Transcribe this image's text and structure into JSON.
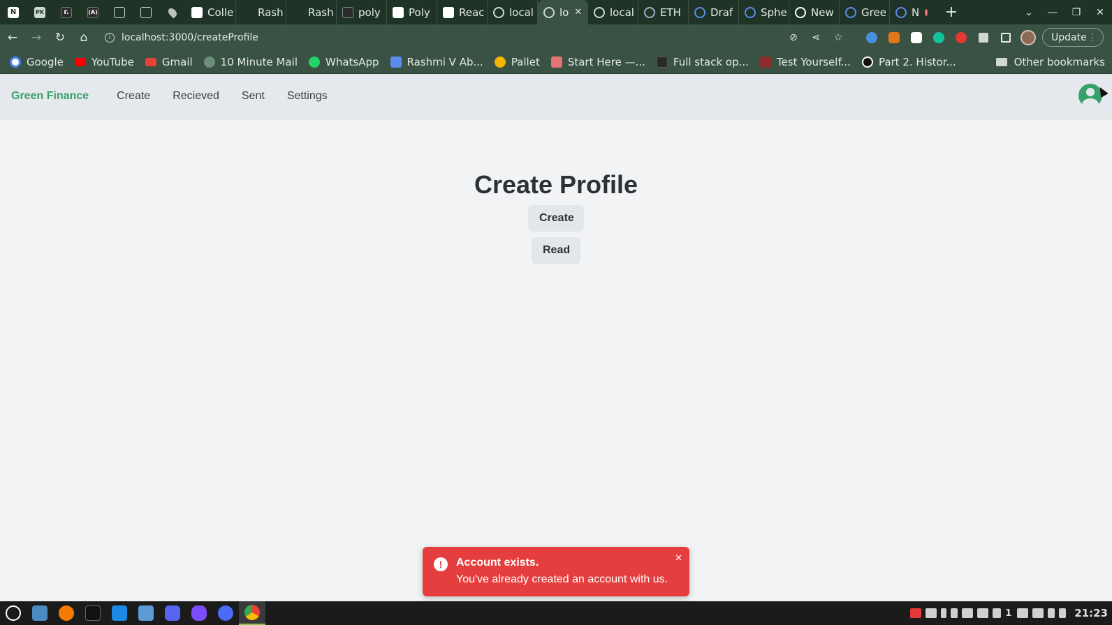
{
  "browser": {
    "pinned_tabs": [
      {
        "icon": "notion-icon",
        "glyph": "N"
      },
      {
        "icon": "pk-icon",
        "glyph": "PK"
      },
      {
        "icon": "r-icon",
        "glyph": "r."
      },
      {
        "icon": "a-icon",
        "glyph": "(A)"
      },
      {
        "icon": "blank-page-icon",
        "glyph": ""
      },
      {
        "icon": "doc-icon",
        "glyph": ""
      },
      {
        "icon": "drop-icon",
        "glyph": ""
      }
    ],
    "tabs": [
      {
        "label": "Colle",
        "active": false
      },
      {
        "label": "Rash",
        "active": false
      },
      {
        "label": "Rash",
        "active": false
      },
      {
        "label": "poly",
        "active": false
      },
      {
        "label": "Poly",
        "active": false
      },
      {
        "label": "Reac",
        "active": false
      },
      {
        "label": "local",
        "active": false
      },
      {
        "label": "lo",
        "active": true
      },
      {
        "label": "local",
        "active": false
      },
      {
        "label": "ETH",
        "active": false
      },
      {
        "label": "Draf",
        "active": false
      },
      {
        "label": "Sphe",
        "active": false
      },
      {
        "label": "New",
        "active": false
      },
      {
        "label": "Gree",
        "active": false
      },
      {
        "label": "N",
        "active": false
      }
    ],
    "address": {
      "url": "localhost:3000/createProfile"
    },
    "update_label": "Update",
    "bookmarks": [
      {
        "label": "Google",
        "color": "#4285f4"
      },
      {
        "label": "YouTube",
        "color": "#ff0000"
      },
      {
        "label": "Gmail",
        "color": "#ea4335"
      },
      {
        "label": "10 Minute Mail",
        "color": "#6b8f7b"
      },
      {
        "label": "WhatsApp",
        "color": "#25d366"
      },
      {
        "label": "Rashmi V Ab...",
        "color": "#5b8def"
      },
      {
        "label": "Pallet",
        "color": "#f4b400"
      },
      {
        "label": "Start Here —...",
        "color": "#e57373"
      },
      {
        "label": "Full stack op...",
        "color": "#2b2b2b"
      },
      {
        "label": "Test Yourself...",
        "color": "#8e2b2b"
      },
      {
        "label": "Part 2. Histor...",
        "color": "#ffffff"
      }
    ],
    "other_bookmarks": "Other bookmarks"
  },
  "app": {
    "brand": "Green Finance",
    "nav": [
      "Create",
      "Recieved",
      "Sent",
      "Settings"
    ],
    "title": "Create Profile",
    "buttons": {
      "create": "Create",
      "read": "Read"
    }
  },
  "toast": {
    "title": "Account exists.",
    "description": "You've already created an account with us.",
    "color": "#e53e3e"
  },
  "taskbar": {
    "clock": "21:23",
    "tray_count": "1"
  },
  "colors": {
    "brand": "#38a169",
    "chrome_dark": "#1f3327",
    "chrome": "#3a5244"
  }
}
